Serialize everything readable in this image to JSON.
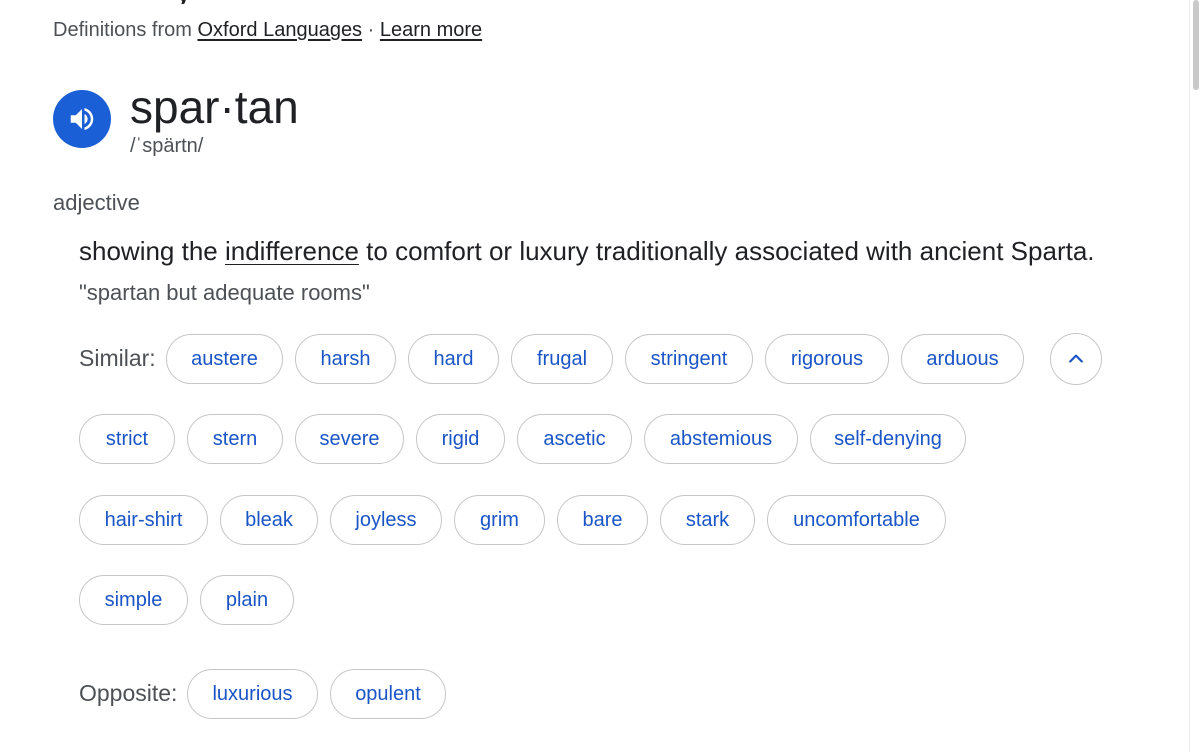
{
  "source": {
    "prefix": "Definitions from",
    "provider_link": "Oxford Languages",
    "separator": "·",
    "learn_more_link": "Learn more"
  },
  "entry": {
    "speaker_icon": "volume-up-icon",
    "headword": "spar·tan",
    "pronunciation": "/ˈspärtn/",
    "part_of_speech": "adjective",
    "definition": {
      "before": "showing the ",
      "link": "indifference",
      "after": " to comfort or luxury traditionally associated with ancient Sparta."
    },
    "example": "\"spartan but adequate rooms\""
  },
  "similar": {
    "label": "Similar:",
    "collapse_icon": "chevron-up-icon",
    "words": [
      "austere",
      "harsh",
      "hard",
      "frugal",
      "stringent",
      "rigorous",
      "arduous",
      "strict",
      "stern",
      "severe",
      "rigid",
      "ascetic",
      "abstemious",
      "self-denying",
      "hair-shirt",
      "bleak",
      "joyless",
      "grim",
      "bare",
      "stark",
      "uncomfortable",
      "simple",
      "plain"
    ]
  },
  "opposite": {
    "label": "Opposite:",
    "words": [
      "luxurious",
      "opulent"
    ]
  },
  "colors": {
    "accent": "#1a5fd6",
    "chip_text": "#1a55c7",
    "chip_border": "#c4c7c5",
    "secondary_text": "#4d5156"
  }
}
